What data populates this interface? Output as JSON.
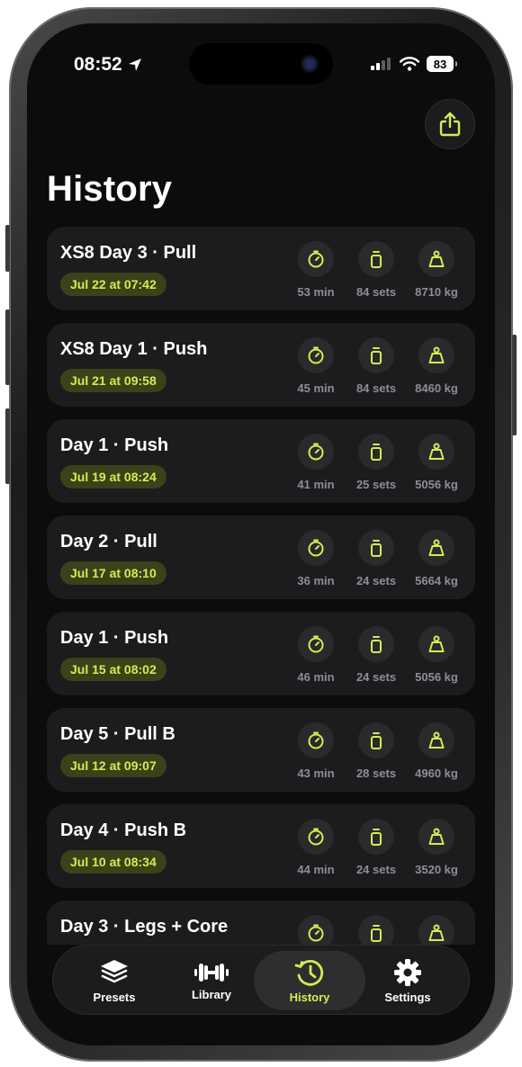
{
  "status": {
    "time": "08:52",
    "battery": "83"
  },
  "colors": {
    "accent": "#d4ec54",
    "card": "#1c1c1e",
    "background": "#0c0c0d"
  },
  "header": {
    "title": "History",
    "share_icon": "share-icon"
  },
  "workouts": [
    {
      "name": "XS8 Day 3 · Pull",
      "date": "Jul 22 at 07:42",
      "duration": "53 min",
      "sets": "84 sets",
      "volume": "8710 kg"
    },
    {
      "name": "XS8 Day 1 · Push",
      "date": "Jul 21 at 09:58",
      "duration": "45 min",
      "sets": "84 sets",
      "volume": "8460 kg"
    },
    {
      "name": "Day 1 · Push",
      "date": "Jul 19 at 08:24",
      "duration": "41 min",
      "sets": "25 sets",
      "volume": "5056 kg"
    },
    {
      "name": "Day 2 · Pull",
      "date": "Jul 17 at 08:10",
      "duration": "36 min",
      "sets": "24 sets",
      "volume": "5664 kg"
    },
    {
      "name": "Day 1 · Push",
      "date": "Jul 15 at 08:02",
      "duration": "46 min",
      "sets": "24 sets",
      "volume": "5056 kg"
    },
    {
      "name": "Day 5 · Pull B",
      "date": "Jul 12 at 09:07",
      "duration": "43 min",
      "sets": "28 sets",
      "volume": "4960 kg"
    },
    {
      "name": "Day 4 · Push B",
      "date": "Jul 10 at 08:34",
      "duration": "44 min",
      "sets": "24 sets",
      "volume": "3520 kg"
    },
    {
      "name": "Day 3 · Legs + Core"
    }
  ],
  "tabs": [
    {
      "label": "Presets",
      "icon": "stack-icon"
    },
    {
      "label": "Library",
      "icon": "dumbbell-icon"
    },
    {
      "label": "History",
      "icon": "history-icon",
      "active": true
    },
    {
      "label": "Settings",
      "icon": "gear-icon"
    }
  ]
}
